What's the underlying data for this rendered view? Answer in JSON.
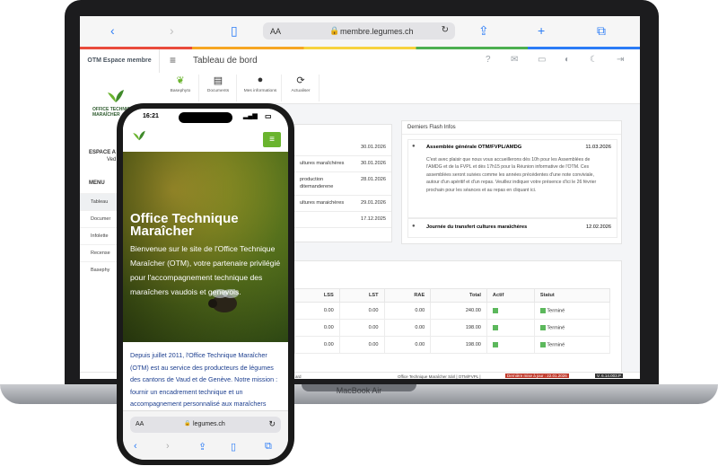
{
  "laptop": {
    "brand": "MacBook Air",
    "browser": {
      "url": "membre.legumes.ch",
      "aa": "AA"
    },
    "app": {
      "brand": "OTM Espace membre",
      "page_title": "Tableau de bord",
      "sidebar": {
        "logo_text": "OFFICE TECHNIQUE MARAÎCHER",
        "space_label": "ESPACE A",
        "space_sub": "Ved",
        "menu_title": "MENU",
        "items": [
          "Tableau",
          "Documer",
          "Infolette",
          "Recense",
          "Basephy"
        ]
      },
      "toolbar": [
        {
          "label": "Basephyto",
          "icon": "leaf-icon"
        },
        {
          "label": "Documents",
          "icon": "documents-icon"
        },
        {
          "label": "Mes informations",
          "icon": "user-icon"
        },
        {
          "label": "Actualiser",
          "icon": "refresh-icon"
        }
      ],
      "news": [
        {
          "text": "",
          "date": "30.01.2026"
        },
        {
          "text": "ultures maraîchères",
          "date": "30.01.2026"
        },
        {
          "text": "production",
          "text2": "ditemanderene",
          "date": "28.01.2026"
        },
        {
          "text": "ultures maraichères",
          "date": "29.01.2026"
        },
        {
          "text": "",
          "date": "17.12.2025"
        }
      ],
      "flash": {
        "title": "Derniers Flash Infos",
        "items": [
          {
            "title": "Assemblée générale OTM/FVPL/AMDG",
            "date": "11.03.2026",
            "body": "C'est avec plaisir que nous vous accueillerons dès 10h pour les Assemblées de l'AMDG et de la FVPL et dès 17h15 pour la Réunion informative de l'OTM. Ces assemblées seront suivies comme les années précédentes d'une note conviviale, autour d'un apéritif et d'un repas. Veuillez indiquer votre présence d'ici le 26 février prochain pour les séances et au repas en cliquant ici."
          },
          {
            "title": "Journée du transfert cultures maraîchères",
            "date": "12.02.2026",
            "body": ""
          }
        ]
      },
      "table": {
        "headers": [
          "LSS",
          "LST",
          "RAE",
          "Total",
          "Actif",
          "Statut"
        ],
        "rows": [
          [
            "0.00",
            "0.00",
            "0.00",
            "240.00",
            "Terminé"
          ],
          [
            "0.00",
            "0.00",
            "0.00",
            "198.00",
            "Terminé"
          ],
          [
            "0.00",
            "0.00",
            "0.00",
            "198.00",
            "Terminé"
          ]
        ]
      },
      "footer": {
        "left": "ard",
        "right": "Office Technique Maraîcher Sàrl | OTM/FVPL | ",
        "badge": "Dernière mise à jour : 22.01.2026",
        "version": "V. 6.14.003.P"
      }
    }
  },
  "phone": {
    "time": "16:21",
    "hero_title": "Office Technique Maraîcher",
    "hero_text": "Bienvenue sur le site de l'Office Technique Maraîcher (OTM), votre partenaire privilégié pour l'accompagnement technique des maraîchers vaudois et genevois.",
    "body_text": "Depuis juillet 2011, l'Office Technique Maraîcher (OTM) est au service des producteurs de légumes des cantons de Vaud et de Genève. Notre mission : fournir un encadrement technique et un accompagnement personnalisé aux maraîchers",
    "url": "legumes.ch",
    "aa": "AA"
  },
  "colors": {
    "accent_green": "#6ab42e",
    "link_blue": "#2b7cf6",
    "status_green": "#5cb85c"
  }
}
